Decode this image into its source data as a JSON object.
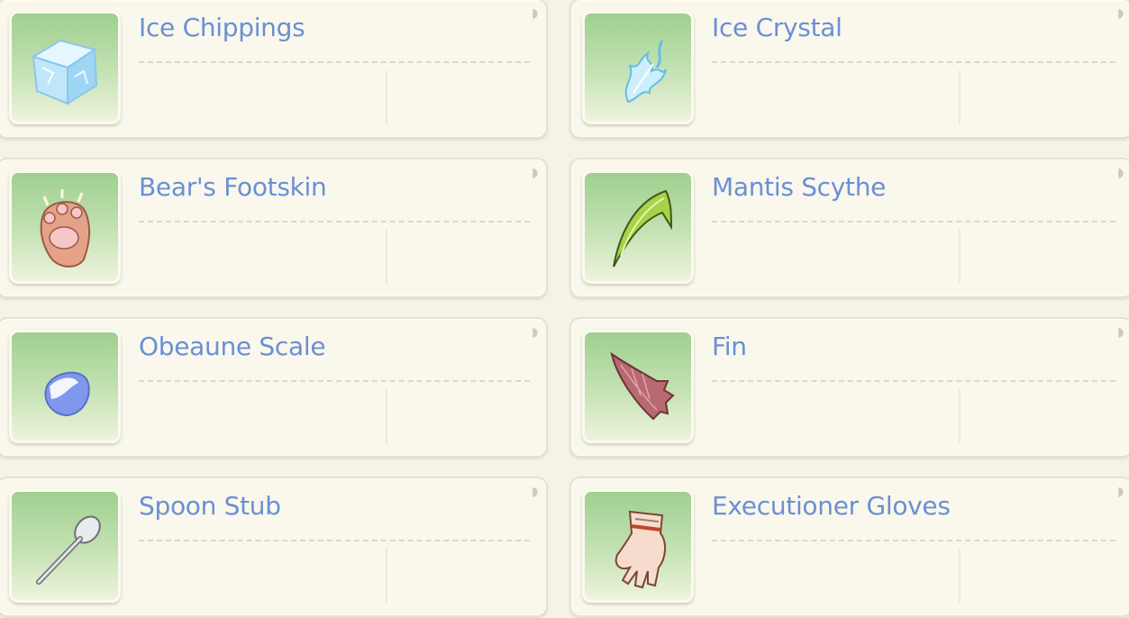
{
  "items": [
    {
      "name": "Ice Chippings",
      "icon": "ice-cube-icon"
    },
    {
      "name": "Ice Crystal",
      "icon": "ice-crystal-icon"
    },
    {
      "name": "Bear's Footskin",
      "icon": "bear-paw-icon"
    },
    {
      "name": "Mantis Scythe",
      "icon": "mantis-scythe-icon"
    },
    {
      "name": "Obeaune Scale",
      "icon": "scale-gem-icon"
    },
    {
      "name": "Fin",
      "icon": "fin-icon"
    },
    {
      "name": "Spoon Stub",
      "icon": "spoon-icon"
    },
    {
      "name": "Executioner Gloves",
      "icon": "glove-icon"
    }
  ],
  "colors": {
    "item_name": "#6a8fd6",
    "card_bg": "#faf8ec",
    "icon_bg_top": "#9fd08e"
  }
}
